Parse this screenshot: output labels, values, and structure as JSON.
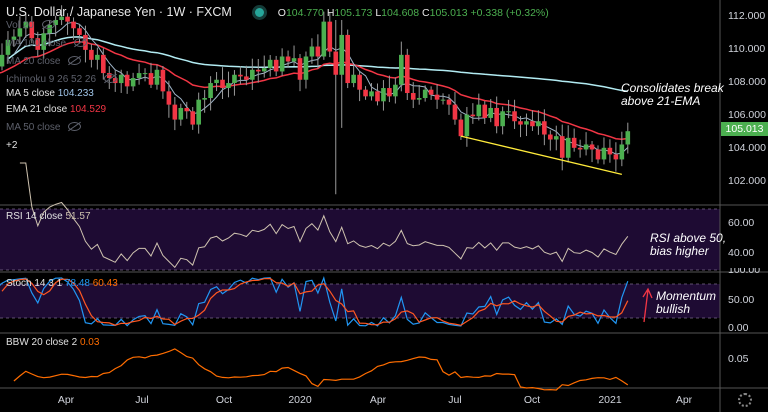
{
  "header": {
    "symbol": "U.S. Dollar / Japanese Yen",
    "interval": "1W",
    "exchange": "FXCM",
    "open": "104.770",
    "high": "105.173",
    "low": "104.608",
    "close": "105.013",
    "change": "+0.338 (+0.32%)",
    "o_label": "O",
    "h_label": "H",
    "l_label": "L",
    "c_label": "C"
  },
  "legend": [
    {
      "label": "Vol 20",
      "value": null,
      "hidden": true
    },
    {
      "label": "MA 100 close",
      "value": null,
      "hidden": true
    },
    {
      "label": "MA 20 close",
      "value": null,
      "hidden": true
    },
    {
      "label": "Ichimoku 9 26 52 26",
      "value": null,
      "hidden": true
    },
    {
      "label": "MA 5 close",
      "value": "104.233",
      "hidden": false
    },
    {
      "label": "EMA 21 close",
      "value": "104.529",
      "hidden": false
    },
    {
      "label": "MA 50 close",
      "value": null,
      "hidden": true
    }
  ],
  "legend_more": "+2",
  "rsi": {
    "label": "RSI 14 close",
    "value": "51.57"
  },
  "stoch": {
    "label": "Stoch 14 3 1",
    "k": "78.48",
    "d": "60.43"
  },
  "bbw": {
    "label": "BBW 20 close 2",
    "value": "0.03"
  },
  "annotations": {
    "main": [
      "Consolidates break",
      "above 21-EMA"
    ],
    "rsi": [
      "RSI above 50,",
      "bias higher"
    ],
    "stoch": [
      "Momentum",
      "bullish"
    ]
  },
  "price_axis": [
    "112.000",
    "110.000",
    "108.000",
    "106.000",
    "104.000",
    "102.000"
  ],
  "last_price": "105.013",
  "rsi_axis": [
    "60.00",
    "40.00"
  ],
  "stoch_axis": [
    "100.00",
    "50.00",
    "0.00"
  ],
  "bbw_axis": [
    "0.05"
  ],
  "time_axis": [
    "Apr",
    "Jul",
    "Oct",
    "2020",
    "Apr",
    "Jul",
    "Oct",
    "2021",
    "Apr"
  ],
  "colors": {
    "up": "#4caf50",
    "down": "#f23645",
    "ma5": "#9fb4c8",
    "ema21": "#f23645",
    "ma100": "#b2ebf2",
    "trend": "#ffeb3b",
    "rsi": "#cfc3b0",
    "k": "#2196f3",
    "d": "#ff5722",
    "bbw": "#ff6d00",
    "band": "#1e0b33"
  },
  "chart_data": {
    "type": "candlestick",
    "title": "U.S. Dollar / Japanese Yen 1W FXCM",
    "ylim": [
      101,
      112.5
    ],
    "closes": [
      108.4,
      108.9,
      109.6,
      110.5,
      110.7,
      111.2,
      111.6,
      110.6,
      109.9,
      110.9,
      111.4,
      111.7,
      111.9,
      111.6,
      111.2,
      110.8,
      109.9,
      109.3,
      109.6,
      108.5,
      108.2,
      107.9,
      108.4,
      107.7,
      108.2,
      108.5,
      108.5,
      107.8,
      108.7,
      107.4,
      106.6,
      105.7,
      106.4,
      106.2,
      105.4,
      106.9,
      107.0,
      107.9,
      108.1,
      107.6,
      107.9,
      108.4,
      108.3,
      108.1,
      108.7,
      108.6,
      108.8,
      109.3,
      108.6,
      109.5,
      109.2,
      109.4,
      108.1,
      109.5,
      110.1,
      109.5,
      111.6,
      109.8,
      108.4,
      110.8,
      107.9,
      108.4,
      107.5,
      107.1,
      107.4,
      106.8,
      107.6,
      107.1,
      107.8,
      109.6,
      107.3,
      106.9,
      107.0,
      107.5,
      107.2,
      106.9,
      106.9,
      106.6,
      105.7,
      104.7,
      106.0,
      105.9,
      106.6,
      105.8,
      106.4,
      105.3,
      106.2,
      106.2,
      105.6,
      105.4,
      105.6,
      105.3,
      105.6,
      104.8,
      104.5,
      104.7,
      103.4,
      104.6,
      104.0,
      103.9,
      104.2,
      103.9,
      103.3,
      104.0,
      103.6,
      103.3,
      104.2,
      105.0
    ],
    "wick_overrides": {
      "56": [
        109.3,
        112.2
      ],
      "58": [
        101.2,
        111.7
      ],
      "59": [
        105.2,
        111.7
      ]
    },
    "trendline": [
      [
        79,
        104.7
      ],
      [
        106,
        102.4
      ]
    ]
  }
}
